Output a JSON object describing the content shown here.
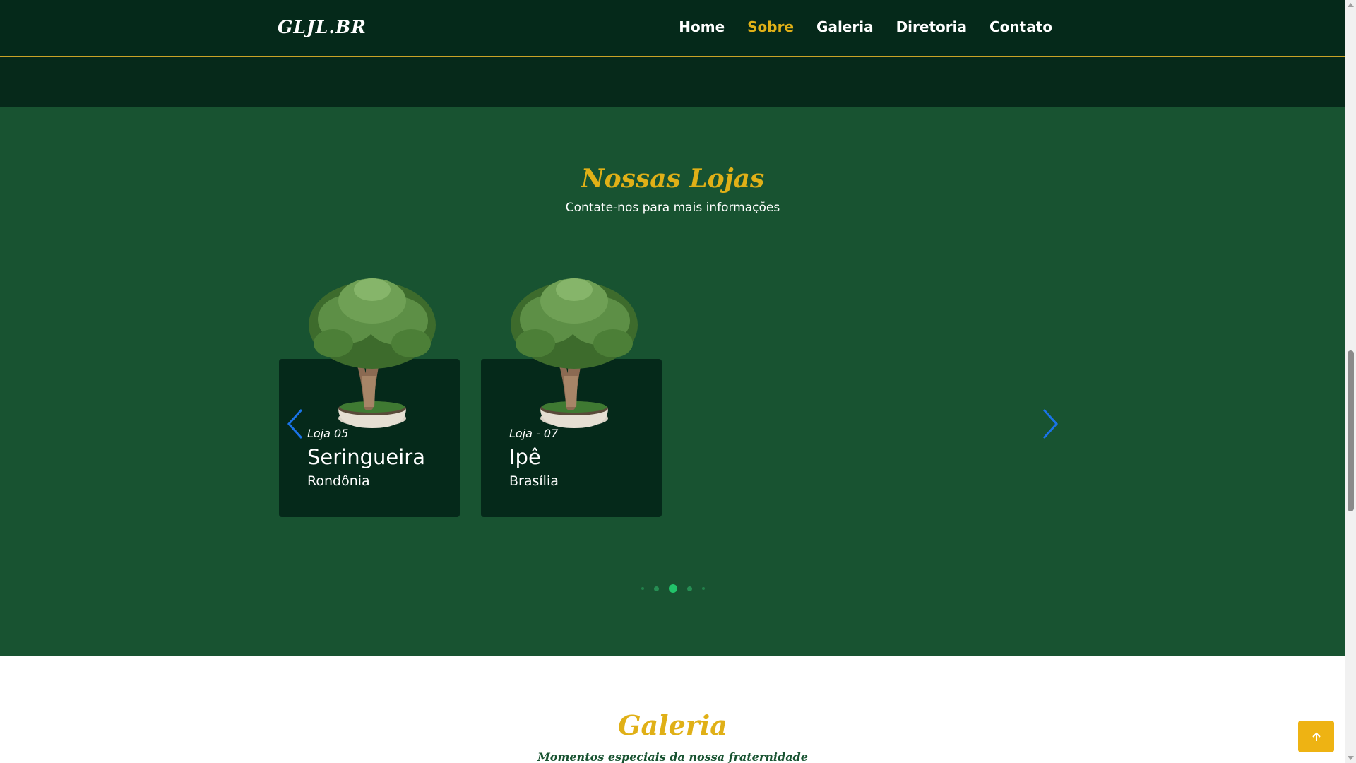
{
  "navbar": {
    "brand": "GLJL.BR",
    "links": [
      {
        "label": "Home",
        "active": false
      },
      {
        "label": "Sobre",
        "active": true
      },
      {
        "label": "Galeria",
        "active": false
      },
      {
        "label": "Diretoria",
        "active": false
      },
      {
        "label": "Contato",
        "active": false
      }
    ]
  },
  "lojas": {
    "title": "Nossas Lojas",
    "subtitle": "Contate-nos para mais informações",
    "cards": [
      {
        "tag": "Loja 05",
        "name": "Seringueira",
        "place": "Rondônia"
      },
      {
        "tag": "Loja - 07",
        "name": "Ipê",
        "place": "Brasília"
      }
    ],
    "pagination": {
      "count": 5,
      "active_index": 2
    }
  },
  "galeria": {
    "title": "Galeria",
    "subtitle": "Momentos especiais da nossa fraternidade"
  },
  "colors": {
    "header_bg": "#05291a",
    "section_bg": "#185331",
    "card_bg": "#05291a",
    "accent_gold": "#e0b017",
    "arrow_blue": "#1a73e8",
    "dot_active": "#22c36a"
  },
  "icons": {
    "prev": "chevron-left-icon",
    "next": "chevron-right-icon",
    "to_top": "arrow-up-icon"
  }
}
